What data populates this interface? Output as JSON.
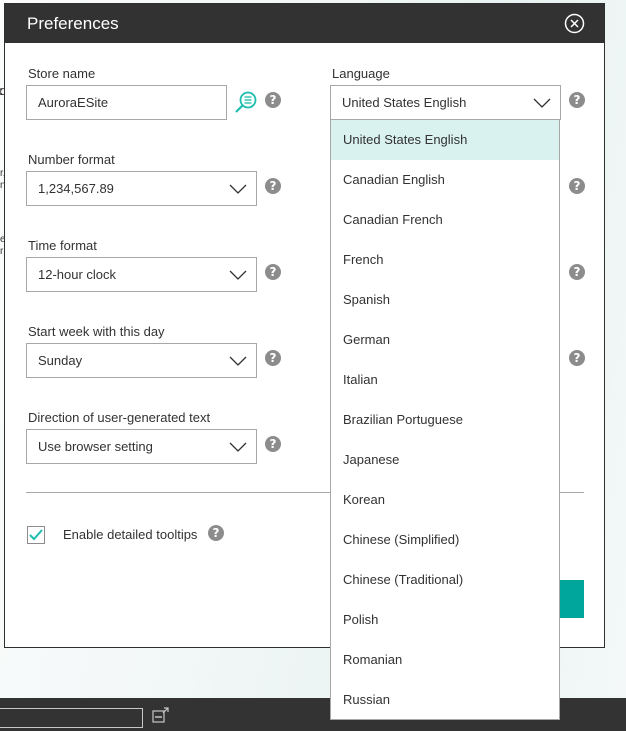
{
  "dialog": {
    "title": "Preferences",
    "close_icon": "close-circle-icon"
  },
  "fields": {
    "store_name": {
      "label": "Store name",
      "value": "AuroraESite",
      "lookup_icon": "search-list-icon"
    },
    "language": {
      "label": "Language",
      "value": "United States English"
    },
    "number_format": {
      "label": "Number format",
      "value": "1,234,567.89"
    },
    "time_format": {
      "label": "Time format",
      "value": "12-hour clock"
    },
    "start_week": {
      "label": "Start week with this day",
      "value": "Sunday"
    },
    "text_direction": {
      "label": "Direction of user-generated text",
      "value": "Use browser setting"
    }
  },
  "tooltips": {
    "label": "Enable detailed tooltips",
    "checked": true
  },
  "help_glyph": "?",
  "language_dropdown": {
    "selected_index": 0,
    "options": [
      "United States English",
      "Canadian English",
      "Canadian French",
      "French",
      "Spanish",
      "German",
      "Italian",
      "Brazilian Portuguese",
      "Japanese",
      "Korean",
      "Chinese (Simplified)",
      "Chinese (Traditional)",
      "Polish",
      "Romanian",
      "Russian"
    ]
  },
  "colors": {
    "header_bg": "#323232",
    "accent": "#00a69c",
    "selected_option_bg": "#d9f2ef"
  },
  "background": {
    "fragments": [
      "r,",
      "n",
      "e",
      "r"
    ]
  }
}
